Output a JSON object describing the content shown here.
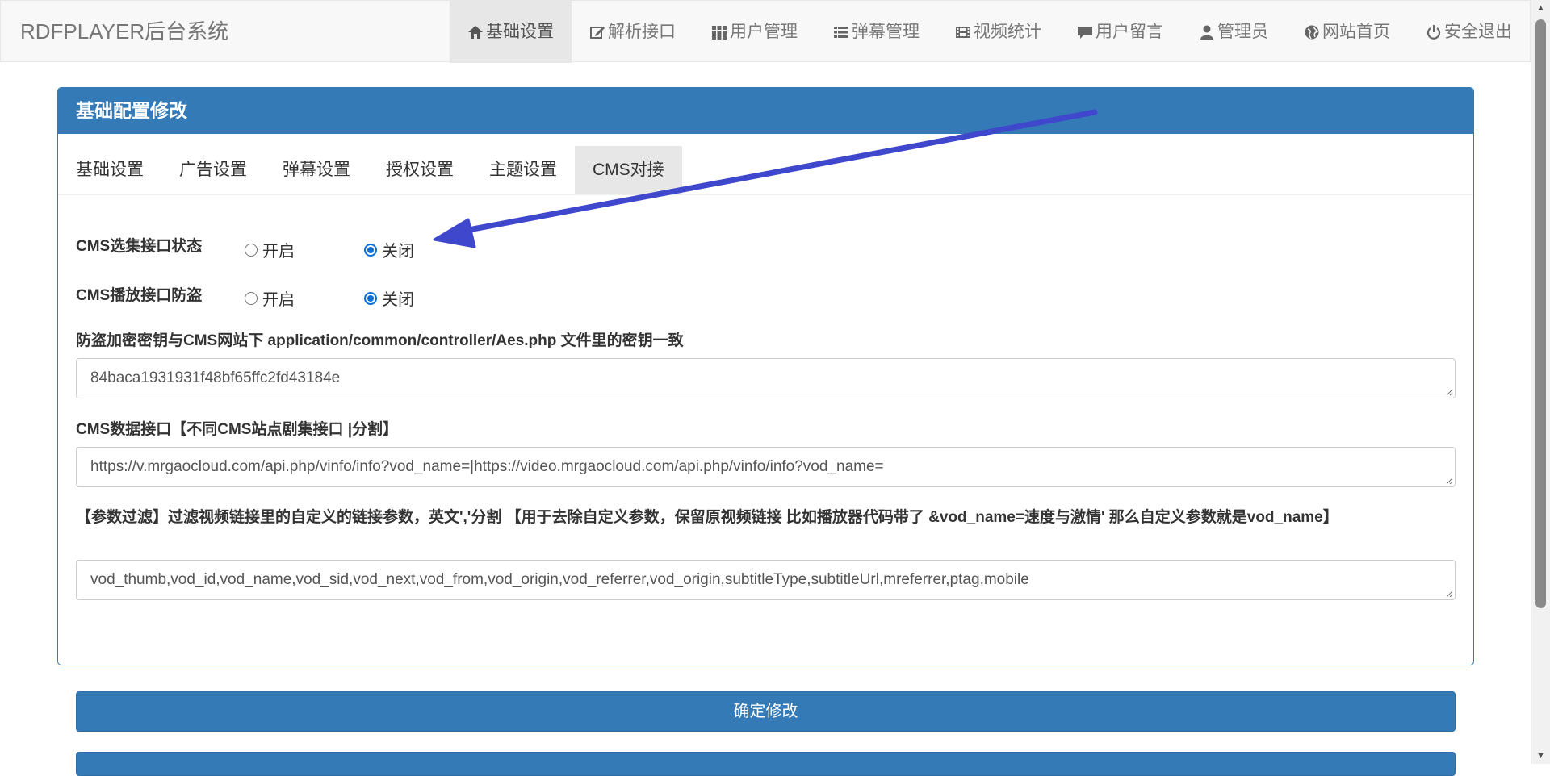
{
  "navbar": {
    "brand": "RDFPLAYER后台系统",
    "items": [
      {
        "label": "基础设置",
        "icon": "home-icon",
        "active": true
      },
      {
        "label": "解析接口",
        "icon": "edit-icon"
      },
      {
        "label": "用户管理",
        "icon": "grid-icon"
      },
      {
        "label": "弹幕管理",
        "icon": "list-icon"
      },
      {
        "label": "视频统计",
        "icon": "film-icon"
      },
      {
        "label": "用户留言",
        "icon": "comment-icon"
      },
      {
        "label": "管理员",
        "icon": "user-icon"
      },
      {
        "label": "网站首页",
        "icon": "globe-icon"
      },
      {
        "label": "安全退出",
        "icon": "power-icon"
      }
    ]
  },
  "panel": {
    "title": "基础配置修改",
    "tabs": [
      "基础设置",
      "广告设置",
      "弹幕设置",
      "授权设置",
      "主题设置",
      "CMS对接"
    ],
    "active_tab": "CMS对接"
  },
  "form": {
    "cms_status": {
      "label": "CMS选集接口状态",
      "on": "开启",
      "off": "关闭",
      "selected": "off"
    },
    "cms_antitheft": {
      "label": "CMS播放接口防盗",
      "on": "开启",
      "off": "关闭",
      "selected": "off"
    },
    "key": {
      "label": "防盗加密密钥与CMS网站下 application/common/controller/Aes.php 文件里的密钥一致",
      "value": "84baca1931931f48bf65ffc2fd43184e"
    },
    "data_api": {
      "label": "CMS数据接口【不同CMS站点剧集接口 |分割】",
      "value": "https://v.mrgaocloud.com/api.php/vinfo/info?vod_name=|https://video.mrgaocloud.com/api.php/vinfo/info?vod_name="
    },
    "param_filter": {
      "label": "【参数过滤】过滤视频链接里的自定义的链接参数，英文','分割 【用于去除自定义参数，保留原视频链接 比如播放器代码带了 &vod_name=速度与激情' 那么自定义参数就是vod_name】",
      "value": "vod_thumb,vod_id,vod_name,vod_sid,vod_next,vod_from,vod_origin,vod_referrer,vod_origin,subtitleType,subtitleUrl,mreferrer,ptag,mobile"
    }
  },
  "buttons": {
    "confirm": "确定修改"
  },
  "colors": {
    "primary": "#337ab7",
    "annotation_arrow": "#3f48cc",
    "radio_checked": "#0b6fd9"
  }
}
